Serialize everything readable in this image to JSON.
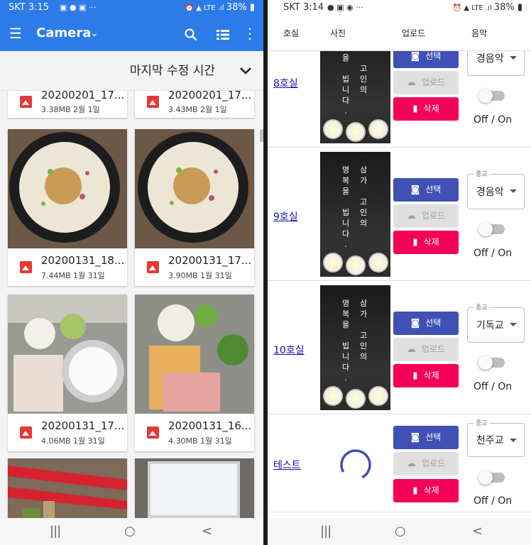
{
  "left": {
    "status": {
      "time": "SKT 3:15",
      "right": "38%"
    },
    "appbar": {
      "title": "Camera"
    },
    "sort": {
      "label": "마지막 수정 시간"
    },
    "files": [
      {
        "name": "20200201_17...",
        "meta": "3.38MB 2월 1일"
      },
      {
        "name": "20200201_17...",
        "meta": "3.43MB 2월 1일"
      },
      {
        "name": "20200131_18...",
        "meta": "7.44MB 1월 31일"
      },
      {
        "name": "20200131_17...",
        "meta": "3.90MB 1월 31일"
      },
      {
        "name": "20200131_17...",
        "meta": "4.06MB 1월 31일"
      },
      {
        "name": "20200131_16...",
        "meta": "4.30MB 1월 31일"
      }
    ],
    "nav": {
      "recent": "|||",
      "home": "○",
      "back": "<"
    }
  },
  "right": {
    "status": {
      "time": "SKT 3:14",
      "right": "38%"
    },
    "headers": {
      "room": "호실",
      "photo": "사진",
      "upload": "업로드",
      "music": "음악"
    },
    "buttons": {
      "select": "선택",
      "upload": "업로드",
      "delete": "삭제"
    },
    "toggle_text": "Off / On",
    "select_legend": "종교",
    "memorial": {
      "col1": [
        "명",
        "복",
        "을",
        "",
        "빕",
        "니",
        "다",
        "."
      ],
      "col2": [
        "삼",
        "가",
        "",
        "고",
        "인",
        "의"
      ]
    },
    "rows": [
      {
        "room": "8호실",
        "music": "경음악"
      },
      {
        "room": "9호실",
        "music": "경음악"
      },
      {
        "room": "10호실",
        "music": "기독교"
      },
      {
        "room": "테스트",
        "music": "천주교"
      }
    ],
    "nav": {
      "recent": "|||",
      "home": "○",
      "back": "<"
    }
  },
  "colors": {
    "appbar": "#2c7be9",
    "select_btn": "#3f51b5",
    "delete_btn": "#f50057",
    "link": "#1a0dab"
  }
}
